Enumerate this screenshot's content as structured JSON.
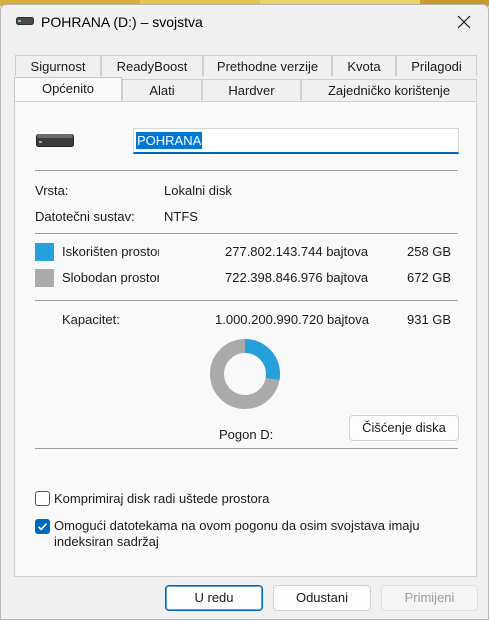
{
  "window": {
    "title": "POHRANA (D:) – svojstva",
    "icons": {
      "title": "drive-icon",
      "close": "close-icon"
    }
  },
  "tabs": {
    "row1": [
      "Sigurnost",
      "ReadyBoost",
      "Prethodne verzije",
      "Kvota",
      "Prilagodi"
    ],
    "row2": [
      "Općenito",
      "Alati",
      "Hardver",
      "Zajedničko korištenje"
    ],
    "active": "Općenito"
  },
  "general": {
    "drive_icon": "drive-icon",
    "name_value": "POHRANA",
    "type_label": "Vrsta:",
    "type_value": "Lokalni disk",
    "fs_label": "Datotečni sustav:",
    "fs_value": "NTFS",
    "used": {
      "label": "Iskorišten prostor:",
      "bytes": "277.802.143.744 bajtova",
      "size": "258 GB",
      "color": "#26a0da"
    },
    "free": {
      "label": "Slobodan prostor:",
      "bytes": "722.398.846.976 bajtova",
      "size": "672 GB",
      "color": "#aaaaaa"
    },
    "capacity": {
      "label": "Kapacitet:",
      "bytes": "1.000.200.990.720 bajtova",
      "size": "931 GB"
    },
    "usage_fraction": 0.2777,
    "drive_label": "Pogon D:",
    "cleanup_button": "Čišćenje diska",
    "compress_label": "Komprimiraj disk radi uštede prostora",
    "compress_checked": false,
    "index_label_line1": "Omogući datotekama na ovom pogonu da osim svojstava imaju",
    "index_label_line2": "indeksiran sadržaj",
    "index_checked": true
  },
  "buttons": {
    "ok": "U redu",
    "cancel": "Odustani",
    "apply": "Primijeni"
  },
  "colors": {
    "accent": "#0067c0",
    "used": "#26a0da",
    "free": "#aaaaaa"
  }
}
